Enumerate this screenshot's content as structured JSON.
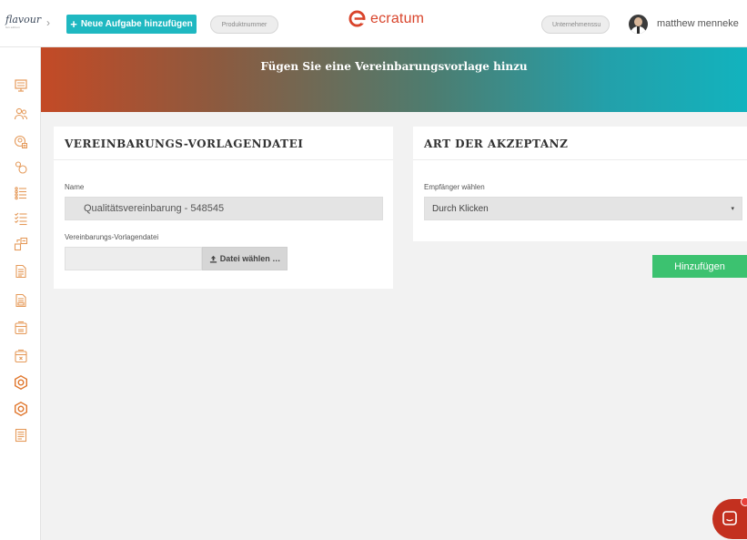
{
  "header": {
    "brand_name": "flavour",
    "brand_sub": "fan edition",
    "chevron_glyph": "›",
    "new_task_plus": "+",
    "new_task_label": "Neue Aufgabe hinzufügen",
    "product_placeholder": "Produktnummer",
    "logo_text": "ecratum",
    "company_placeholder": "Unternehmenssu",
    "user_name": "matthew menneke",
    "accent_color": "#1fb8c1",
    "logo_color": "#d9442b"
  },
  "sidebar": {
    "items": [
      {
        "icon": "monitor-icon",
        "color": "#e59a5a"
      },
      {
        "icon": "users-icon",
        "color": "#e59a5a"
      },
      {
        "icon": "user-profile-icon",
        "color": "#e59a5a"
      },
      {
        "icon": "network-icon",
        "color": "#e59a5a"
      },
      {
        "icon": "list-icon",
        "color": "#e59a5a"
      },
      {
        "icon": "checklist-icon",
        "color": "#e59a5a"
      },
      {
        "icon": "transfer-icon",
        "color": "#e59a5a"
      },
      {
        "icon": "document-icon",
        "color": "#e59a5a"
      },
      {
        "icon": "document-edit-icon",
        "color": "#e59a5a"
      },
      {
        "icon": "box-icon",
        "color": "#e59a5a"
      },
      {
        "icon": "box-cancel-icon",
        "color": "#e59a5a"
      },
      {
        "icon": "hex-settings-icon",
        "color": "#e0762c"
      },
      {
        "icon": "hex-settings-alt-icon",
        "color": "#e0762c"
      },
      {
        "icon": "report-icon",
        "color": "#e59a5a"
      }
    ]
  },
  "banner": {
    "title": "Fügen Sie eine Vereinbarungsvorlage hinzu"
  },
  "template_card": {
    "title": "VEREINBARUNGS-VORLAGENDATEI",
    "name_label": "Name",
    "name_value": "Qualitätsvereinbarung - 548545",
    "file_label": "Vereinbarungs-Vorlagendatei",
    "file_button_label": "Datei wählen …"
  },
  "acceptance_card": {
    "title": "ART DER AKZEPTANZ",
    "recipient_label": "Empfänger wählen",
    "recipient_value": "Durch Klicken",
    "caret": "▾"
  },
  "actions": {
    "add_label": "Hinzufügen",
    "add_color": "#3cc270"
  }
}
